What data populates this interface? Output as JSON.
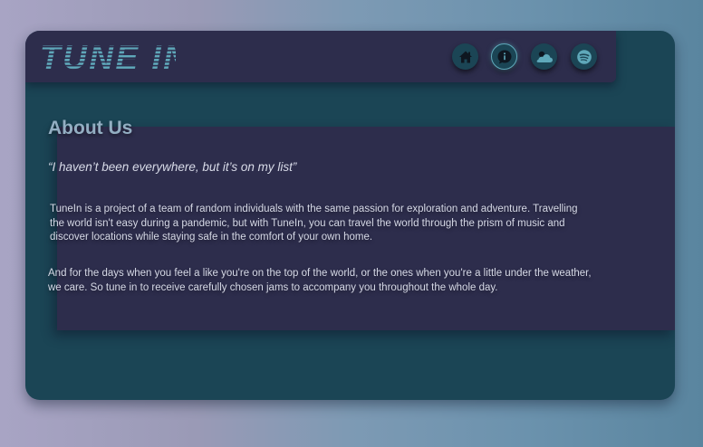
{
  "header": {
    "logo_text": "TUNE IN",
    "nav": [
      {
        "icon": "home-icon",
        "label": "Home"
      },
      {
        "icon": "info-icon",
        "label": "About"
      },
      {
        "icon": "weather-icon",
        "label": "Weather"
      },
      {
        "icon": "spotify-icon",
        "label": "Spotify"
      }
    ]
  },
  "about": {
    "title": "About Us",
    "quote": "“I haven’t been everywhere, but it’s on my list”",
    "paragraph1": "TuneIn is a project of a team of random individuals with the same passion for exploration and adventure. Travelling the world isn't easy during a pandemic, but with TuneIn, you can travel the world through the prism of music and discover locations while staying safe in the comfort of your own home.",
    "paragraph2": "And for the days when you feel a like you're on the top of the world, or the ones when you're a little under the weather, we care. So tune in to receive carefully chosen jams to accompany you throughout the whole day."
  },
  "colors": {
    "frame": "#1b4555",
    "panel": "#2d2d4c",
    "accent": "#5fa8ba",
    "title": "#93aec2"
  }
}
